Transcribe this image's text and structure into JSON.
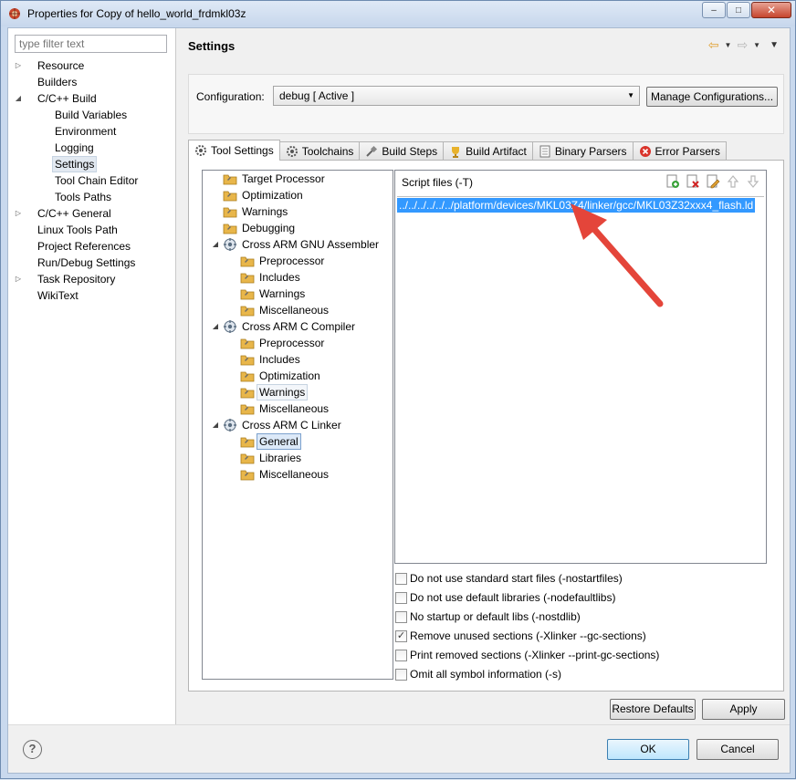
{
  "window": {
    "title": "Properties for Copy of hello_world_frdmkl03z",
    "controls": {
      "minimize": "–",
      "maximize": "□",
      "close": "✕"
    }
  },
  "nav": {
    "filter_placeholder": "type filter text",
    "items": [
      {
        "label": "Resource",
        "level": 0,
        "expander": "▷"
      },
      {
        "label": "Builders",
        "level": 0,
        "expander": ""
      },
      {
        "label": "C/C++ Build",
        "level": 0,
        "expander": "◢"
      },
      {
        "label": "Build Variables",
        "level": 1,
        "expander": ""
      },
      {
        "label": "Environment",
        "level": 1,
        "expander": ""
      },
      {
        "label": "Logging",
        "level": 1,
        "expander": ""
      },
      {
        "label": "Settings",
        "level": 1,
        "expander": "",
        "selected": true
      },
      {
        "label": "Tool Chain Editor",
        "level": 1,
        "expander": ""
      },
      {
        "label": "Tools Paths",
        "level": 1,
        "expander": ""
      },
      {
        "label": "C/C++ General",
        "level": 0,
        "expander": "▷"
      },
      {
        "label": "Linux Tools Path",
        "level": 0,
        "expander": ""
      },
      {
        "label": "Project References",
        "level": 0,
        "expander": ""
      },
      {
        "label": "Run/Debug Settings",
        "level": 0,
        "expander": ""
      },
      {
        "label": "Task Repository",
        "level": 0,
        "expander": "▷"
      },
      {
        "label": "WikiText",
        "level": 0,
        "expander": ""
      }
    ]
  },
  "page": {
    "title": "Settings",
    "config_label": "Configuration:",
    "config_value": "debug  [ Active ]",
    "manage_button": "Manage Configurations..."
  },
  "tabs": [
    {
      "label": "Tool Settings",
      "icon": "tool-settings-icon",
      "active": true
    },
    {
      "label": "Toolchains",
      "icon": "toolchains-icon"
    },
    {
      "label": "Build Steps",
      "icon": "build-steps-icon"
    },
    {
      "label": "Build Artifact",
      "icon": "build-artifact-icon"
    },
    {
      "label": "Binary Parsers",
      "icon": "binary-parsers-icon"
    },
    {
      "label": "Error Parsers",
      "icon": "error-parsers-icon"
    }
  ],
  "settings_tree": [
    {
      "label": "Target Processor",
      "level": 0,
      "kind": "option"
    },
    {
      "label": "Optimization",
      "level": 0,
      "kind": "option"
    },
    {
      "label": "Warnings",
      "level": 0,
      "kind": "option"
    },
    {
      "label": "Debugging",
      "level": 0,
      "kind": "option"
    },
    {
      "label": "Cross ARM GNU Assembler",
      "level": 0,
      "kind": "tool",
      "expander": "◢"
    },
    {
      "label": "Preprocessor",
      "level": 1,
      "kind": "option"
    },
    {
      "label": "Includes",
      "level": 1,
      "kind": "option"
    },
    {
      "label": "Warnings",
      "level": 1,
      "kind": "option"
    },
    {
      "label": "Miscellaneous",
      "level": 1,
      "kind": "option"
    },
    {
      "label": "Cross ARM C Compiler",
      "level": 0,
      "kind": "tool",
      "expander": "◢"
    },
    {
      "label": "Preprocessor",
      "level": 1,
      "kind": "option"
    },
    {
      "label": "Includes",
      "level": 1,
      "kind": "option"
    },
    {
      "label": "Optimization",
      "level": 1,
      "kind": "option"
    },
    {
      "label": "Warnings",
      "level": 1,
      "kind": "option",
      "highlight": true
    },
    {
      "label": "Miscellaneous",
      "level": 1,
      "kind": "option"
    },
    {
      "label": "Cross ARM C Linker",
      "level": 0,
      "kind": "tool",
      "expander": "◢"
    },
    {
      "label": "General",
      "level": 1,
      "kind": "option",
      "selected": true
    },
    {
      "label": "Libraries",
      "level": 1,
      "kind": "option"
    },
    {
      "label": "Miscellaneous",
      "level": 1,
      "kind": "option"
    }
  ],
  "script_files": {
    "title": "Script files (-T)",
    "entries": [
      "../../../../../../platform/devices/MKL03Z4/linker/gcc/MKL03Z32xxx4_flash.ld"
    ],
    "tools": [
      "add-file-icon",
      "delete-icon",
      "edit-icon",
      "move-up-icon",
      "move-down-icon"
    ]
  },
  "checkboxes": [
    {
      "label": "Do not use standard start files (-nostartfiles)",
      "checked": false
    },
    {
      "label": "Do not use default libraries (-nodefaultlibs)",
      "checked": false
    },
    {
      "label": "No startup or default libs (-nostdlib)",
      "checked": false
    },
    {
      "label": "Remove unused sections (-Xlinker --gc-sections)",
      "checked": true
    },
    {
      "label": "Print removed sections (-Xlinker --print-gc-sections)",
      "checked": false
    },
    {
      "label": "Omit all symbol information (-s)",
      "checked": false
    }
  ],
  "buttons": {
    "restore_defaults": "Restore Defaults",
    "apply": "Apply",
    "ok": "OK",
    "cancel": "Cancel",
    "help": "?"
  },
  "colors": {
    "selection": "#3399ff",
    "annotation_arrow": "#e74c3c",
    "folder": "#e8b64a"
  }
}
